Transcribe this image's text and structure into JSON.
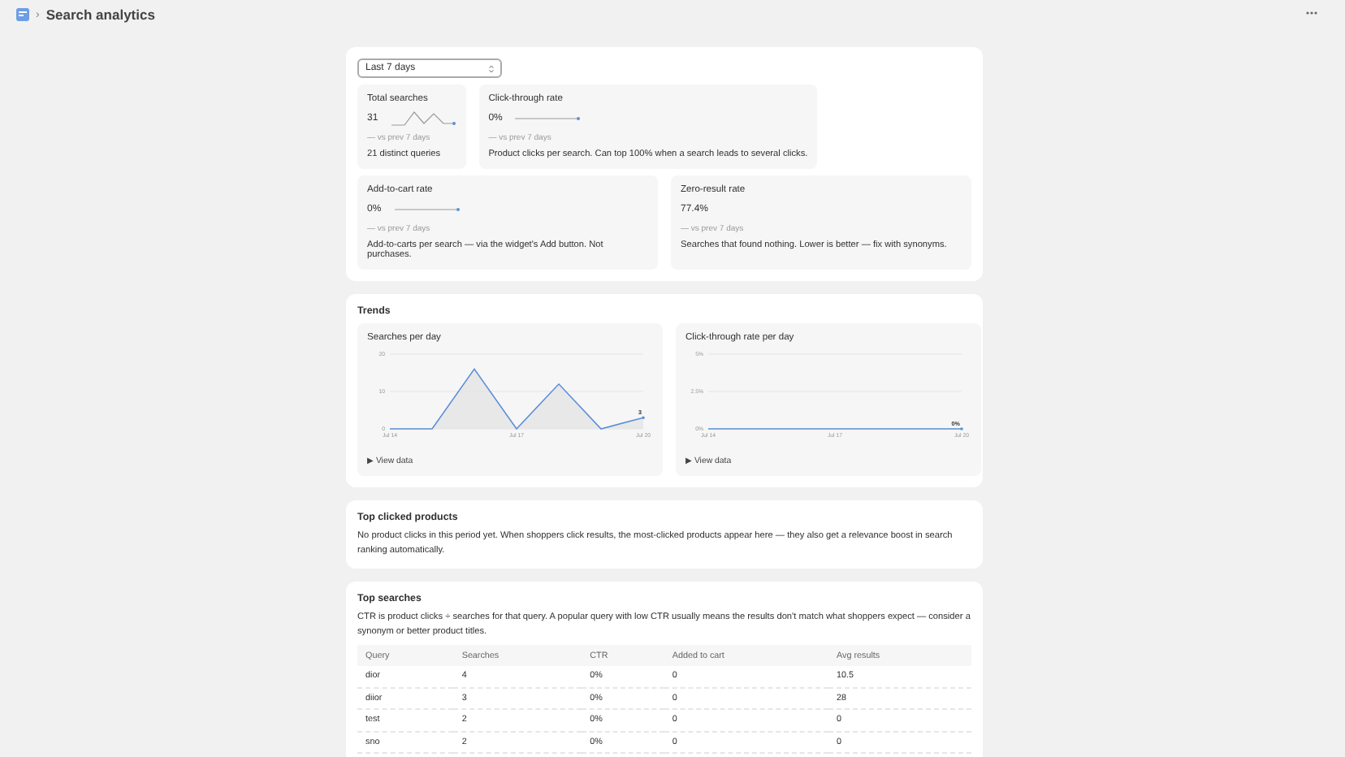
{
  "header": {
    "separator": "›",
    "title": "Search analytics"
  },
  "range": {
    "value": "Last 7 days"
  },
  "metrics": [
    {
      "label": "Total searches",
      "value": "31",
      "sparkline": true,
      "compare": "— vs prev 7 days",
      "note": "21 distinct queries"
    },
    {
      "label": "Click-through rate",
      "value": "0%",
      "sparkline": true,
      "compare": "— vs prev 7 days",
      "note": "Product clicks per search. Can top 100% when a search leads to several clicks."
    },
    {
      "label": "Add-to-cart rate",
      "value": "0%",
      "sparkline": true,
      "compare": "— vs prev 7 days",
      "note": "Add-to-carts per search — via the widget's Add button. Not purchases."
    },
    {
      "label": "Zero-result rate",
      "value": "77.4%",
      "sparkline": false,
      "compare": "— vs prev 7 days",
      "note": "Searches that found nothing. Lower is better — fix with synonyms."
    }
  ],
  "trends": {
    "title": "Trends",
    "charts": [
      {
        "title": "Searches per day",
        "toggle": "▶ View data",
        "end_label": "3",
        "chart_data": {
          "type": "area",
          "categories": [
            "Jul 14",
            null,
            null,
            "Jul 17",
            null,
            null,
            "Jul 20"
          ],
          "ylim": [
            0,
            20
          ],
          "yticks": [
            0,
            10,
            20
          ],
          "series": [
            {
              "color": "#5b8fd9",
              "values": [
                0,
                0,
                16,
                0,
                12,
                0,
                3
              ]
            }
          ]
        }
      },
      {
        "title": "Click-through rate per day",
        "toggle": "▶ View data",
        "end_label": "0%",
        "chart_data": {
          "type": "line",
          "categories": [
            "Jul 14",
            null,
            null,
            "Jul 17",
            null,
            null,
            "Jul 20"
          ],
          "ylim": [
            0,
            5
          ],
          "yticks": [
            {
              "value": 0,
              "label": "0%"
            },
            {
              "value": 2.5,
              "label": "2.5%"
            },
            {
              "value": 5,
              "label": "5%"
            }
          ],
          "series": [
            {
              "color": "#5b8fd9",
              "values": [
                0,
                0,
                0,
                0,
                0,
                0,
                0
              ]
            }
          ]
        }
      }
    ]
  },
  "top_clicked": {
    "title": "Top clicked products",
    "text": "No product clicks in this period yet. When shoppers click results, the most-clicked products appear here — they also get a relevance boost in search ranking automatically."
  },
  "top_searches": {
    "title": "Top searches",
    "text": "CTR is product clicks ÷ searches for that query. A popular query with low CTR usually means the results don't match what shoppers expect — consider a synonym or better product titles.",
    "columns": [
      "Query",
      "Searches",
      "CTR",
      "Added to cart",
      "Avg results"
    ],
    "rows": [
      [
        "dior",
        "4",
        "0%",
        "0",
        "10.5"
      ],
      [
        "diior",
        "3",
        "0%",
        "0",
        "28"
      ],
      [
        "test",
        "2",
        "0%",
        "0",
        "0"
      ],
      [
        "sno",
        "2",
        "0%",
        "0",
        "0"
      ]
    ]
  }
}
